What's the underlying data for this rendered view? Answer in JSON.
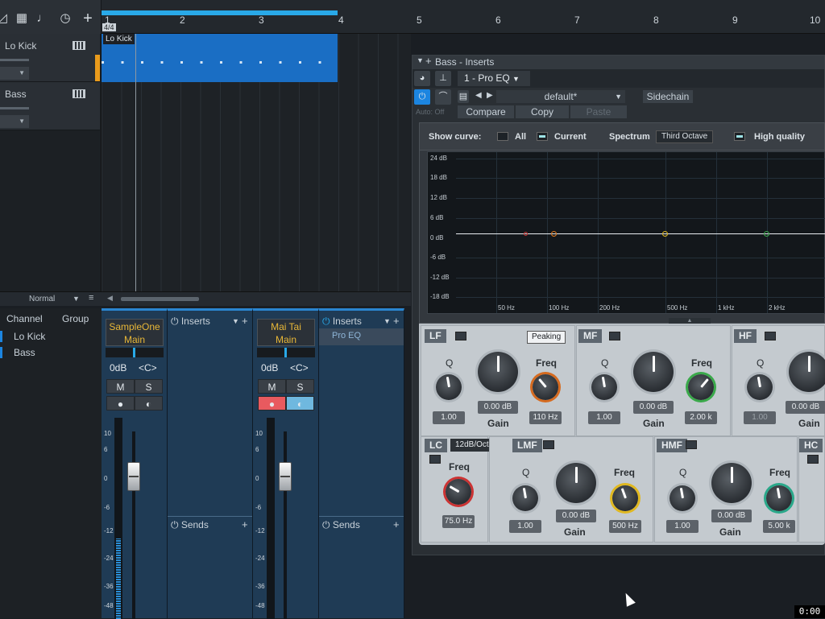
{
  "ruler": {
    "bars": [
      "1",
      "2",
      "3",
      "4",
      "5",
      "6",
      "7",
      "8",
      "9",
      "10"
    ],
    "time_sig": "4/4"
  },
  "tracks": [
    {
      "name": "Lo Kick"
    },
    {
      "name": "Bass"
    }
  ],
  "clip": {
    "name": "Lo Kick"
  },
  "arrange": {
    "mode": "Normal"
  },
  "channels": {
    "col_channel": "Channel",
    "col_group": "Group",
    "items": [
      "Lo Kick",
      "Bass"
    ]
  },
  "strip1": {
    "name": "SampleOne",
    "out": "Main",
    "vol": "0dB",
    "pan": "<C>",
    "mute": "M",
    "solo": "S",
    "scale": [
      "10",
      "6",
      "0",
      "-6",
      "-12",
      "-24",
      "-36",
      "-48"
    ]
  },
  "strip2": {
    "name": "Mai Tai",
    "out": "Main",
    "vol": "0dB",
    "pan": "<C>",
    "mute": "M",
    "solo": "S",
    "scale": [
      "10",
      "6",
      "0",
      "-6",
      "-12",
      "-24",
      "-36",
      "-48"
    ]
  },
  "inserts1": {
    "title": "Inserts",
    "sends": "Sends"
  },
  "inserts2": {
    "title": "Inserts",
    "sends": "Sends",
    "slot": "Pro EQ"
  },
  "plugin": {
    "title": "Bass - Inserts",
    "preset_slot": "1 - Pro EQ",
    "preset": "default*",
    "sidechain": "Sidechain",
    "auto": "Auto: Off",
    "compare": "Compare",
    "copy": "Copy",
    "paste": "Paste"
  },
  "eq": {
    "show_curve": "Show curve:",
    "all": "All",
    "current": "Current",
    "spectrum": "Spectrum",
    "spectrum_mode": "Third Octave",
    "hq": "High quality",
    "y_labels": [
      "24 dB",
      "18 dB",
      "12 dB",
      "6 dB",
      "0 dB",
      "-6 dB",
      "-12 dB",
      "-18 dB"
    ],
    "x_labels": [
      "50 Hz",
      "100 Hz",
      "200 Hz",
      "500 Hz",
      "1 kHz",
      "2 kHz"
    ],
    "lf": {
      "label": "LF",
      "mode": "Peaking",
      "q_label": "Q",
      "q": "1.00",
      "gain_label": "Gain",
      "gain": "0.00 dB",
      "freq_label": "Freq",
      "freq": "110 Hz"
    },
    "mf": {
      "label": "MF",
      "q_label": "Q",
      "q": "1.00",
      "gain_label": "Gain",
      "gain": "0.00 dB",
      "freq_label": "Freq",
      "freq": "2.00 k"
    },
    "hf": {
      "label": "HF",
      "q_label": "Q",
      "q": "1.00",
      "gain_label": "Gain",
      "gain": "0.00 dB"
    },
    "lc": {
      "label": "LC",
      "slope": "12dB/Oct",
      "freq_label": "Freq",
      "freq": "75.0 Hz"
    },
    "lmf": {
      "label": "LMF",
      "q_label": "Q",
      "q": "1.00",
      "gain_label": "Gain",
      "gain": "0.00 dB",
      "freq_label": "Freq",
      "freq": "500 Hz"
    },
    "hmf": {
      "label": "HMF",
      "q_label": "Q",
      "q": "1.00",
      "gain_label": "Gain",
      "gain": "0.00 dB",
      "freq_label": "Freq",
      "freq": "5.00 k"
    },
    "hc": {
      "label": "HC"
    }
  },
  "clock": "0:00"
}
